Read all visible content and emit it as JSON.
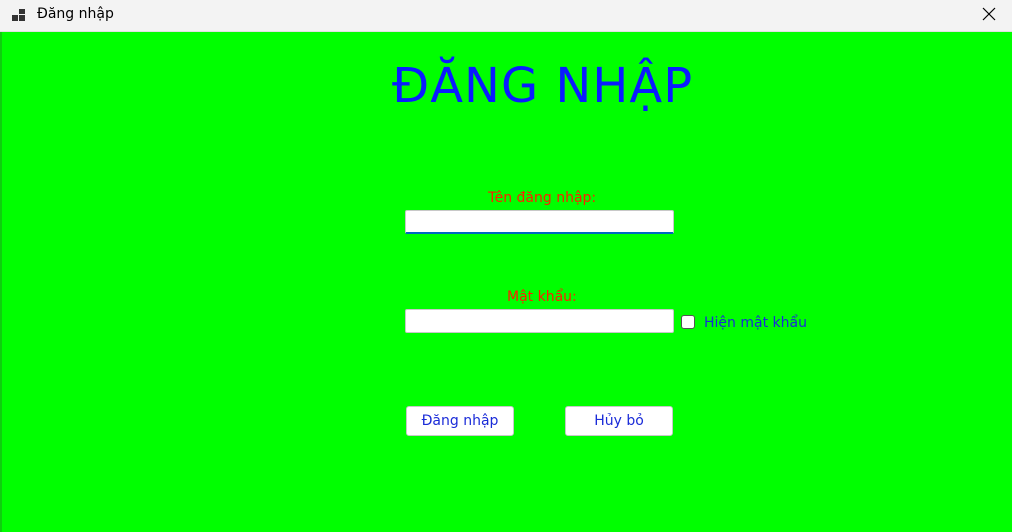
{
  "window": {
    "title": "Đăng nhập",
    "background_color": "#00ff00"
  },
  "heading": "ĐĂNG NHẬP",
  "form": {
    "username_label": "Tên đăng nhập:",
    "username_value": "",
    "password_label": "Mật khẩu:",
    "password_value": "",
    "show_password_label": "Hiện mật khẩu",
    "show_password_checked": false
  },
  "buttons": {
    "login_label": "Đăng nhập",
    "cancel_label": "Hủy bỏ"
  },
  "colors": {
    "heading": "#0a1bff",
    "label": "#ff1f00",
    "button_text": "#1a2bd8"
  },
  "icons": {
    "app": "app-window-icon",
    "close": "close-icon"
  }
}
